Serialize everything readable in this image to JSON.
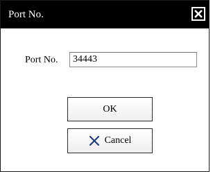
{
  "dialog": {
    "title": "Port No.",
    "close_icon": "close-icon"
  },
  "form": {
    "port_label": "Port No.",
    "port_value": "34443"
  },
  "buttons": {
    "ok_label": "OK",
    "cancel_label": "Cancel",
    "cancel_icon": "x-icon"
  },
  "colors": {
    "titlebar": "#000000",
    "title_text": "#ffffff",
    "cancel_icon": "#1f3b7a"
  }
}
